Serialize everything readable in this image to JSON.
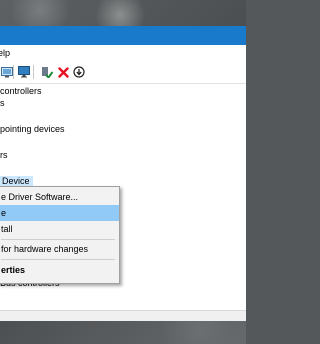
{
  "menubar": {
    "help_label": "elp"
  },
  "tree": {
    "items": [
      {
        "label": "controllers"
      },
      {
        "label": "s"
      },
      {
        "label": "pointing devices"
      },
      {
        "label": "rs"
      },
      {
        "label": "Device"
      },
      {
        "label": "Bus controllers"
      }
    ]
  },
  "context_menu": {
    "items": [
      {
        "label": "e Driver Software..."
      },
      {
        "label": "e"
      },
      {
        "label": "tall"
      },
      {
        "label": "for hardware changes"
      },
      {
        "label": "erties"
      }
    ]
  },
  "colors": {
    "titlebar": "#1979ca",
    "selection": "#cce8ff",
    "menu_highlight": "#91c9f7",
    "delete_red": "#e81123",
    "enable_green": "#1e8c3a"
  },
  "icons": [
    "computer-icon",
    "monitor-icon",
    "enable-device-icon",
    "uninstall-icon",
    "update-driver-icon"
  ]
}
